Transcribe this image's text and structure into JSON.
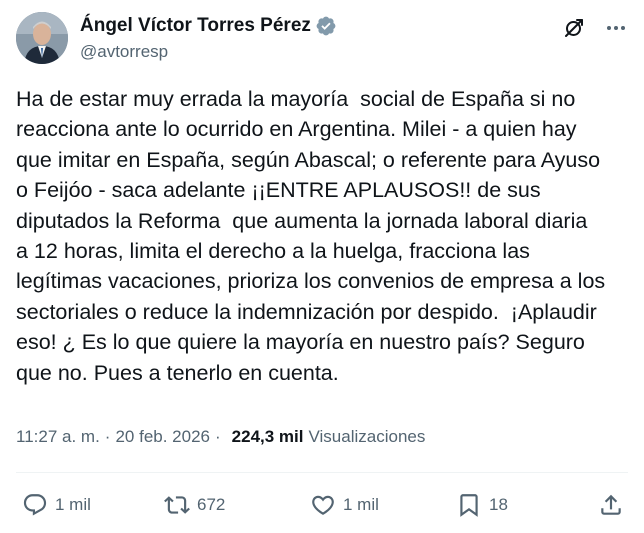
{
  "author": {
    "display_name": "Ángel Víctor Torres Pérez",
    "handle": "@avtorresp",
    "verified_icon": "verified-badge-icon",
    "verified_color": "#829aab"
  },
  "tweet": {
    "text": "Ha de estar muy errada la mayoría  social de España si no\nreacciona ante lo ocurrido en Argentina. Milei - a quien hay\nque imitar en España, según Abascal; o referente para Ayuso\no Feijóo - saca adelante ¡¡ENTRE APLAUSOS!! de sus\ndiputados la Reforma  que aumenta la jornada laboral diaria\na 12 horas, limita el derecho a la huelga, fracciona las\nlegítimas vacaciones, prioriza los convenios de empresa a los\nsectoriales o reduce la indemnización por despido.  ¡Aplaudir\neso! ¿ Es lo que quiere la mayoría en nuestro país? Seguro\nque no. Pues a tenerlo en cuenta."
  },
  "meta": {
    "time": "11:27 a. m.",
    "separator": "·",
    "date": "20 feb. 2026",
    "views_count": "224,3 mil",
    "views_label": "Visualizaciones"
  },
  "actions": {
    "reply": {
      "icon": "reply-icon",
      "count": "1 mil"
    },
    "retweet": {
      "icon": "retweet-icon",
      "count": "672"
    },
    "like": {
      "icon": "heart-icon",
      "count": "1 mil"
    },
    "bookmark": {
      "icon": "bookmark-icon",
      "count": "18"
    },
    "share": {
      "icon": "share-icon"
    }
  },
  "header_icons": {
    "grok": "grok-icon",
    "more": "more-icon"
  },
  "colors": {
    "text_primary": "#0f1419",
    "text_secondary": "#536471",
    "divider": "#eff3f4"
  }
}
